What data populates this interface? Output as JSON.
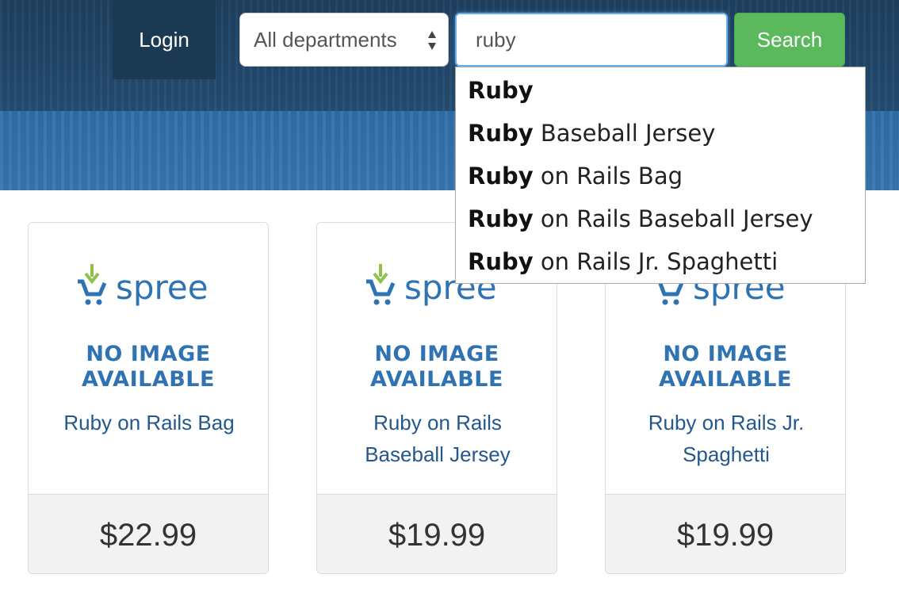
{
  "header": {
    "login_label": "Login",
    "department": {
      "selected": "All departments"
    },
    "search": {
      "value": "ruby",
      "button_label": "Search"
    }
  },
  "autocomplete": {
    "items": [
      {
        "match": "Ruby",
        "rest": ""
      },
      {
        "match": "Ruby",
        "rest": " Baseball Jersey"
      },
      {
        "match": "Ruby",
        "rest": " on Rails Bag"
      },
      {
        "match": "Ruby",
        "rest": " on Rails Baseball Jersey"
      },
      {
        "match": "Ruby",
        "rest": " on Rails Jr. Spaghetti"
      }
    ]
  },
  "products": [
    {
      "name": "Ruby on Rails Bag",
      "price": "$22.99",
      "logo_text": "spree",
      "no_image": "NO IMAGE\nAVAILABLE"
    },
    {
      "name": "Ruby on Rails Baseball Jersey",
      "price": "$19.99",
      "logo_text": "spree",
      "no_image": "NO IMAGE\nAVAILABLE"
    },
    {
      "name": "Ruby on Rails Jr. Spaghetti",
      "price": "$19.99",
      "logo_text": "spree",
      "no_image": "NO IMAGE\nAVAILABLE"
    }
  ],
  "colors": {
    "accent_green": "#5cb85c",
    "link_blue": "#24588a",
    "spree_blue": "#2f73b3",
    "spree_green": "#8cc24a"
  },
  "icons": {
    "select_arrows": "chevron-up-down-icon",
    "product_logo": "spree-cart-icon"
  }
}
